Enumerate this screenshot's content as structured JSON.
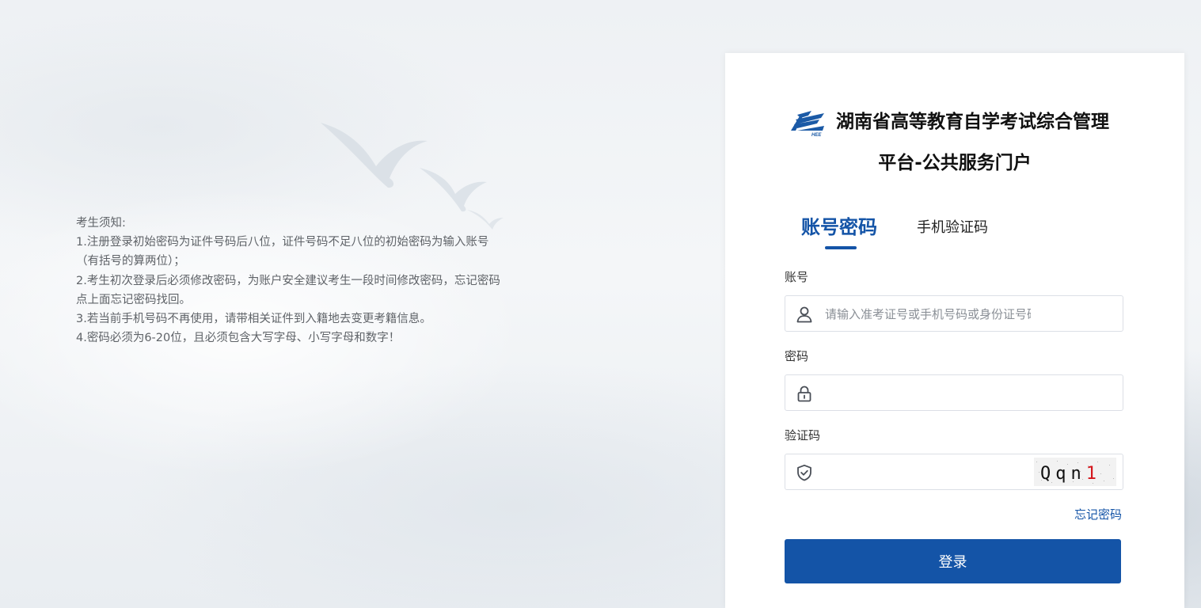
{
  "notice": {
    "heading": "考生须知:",
    "items": [
      "1.注册登录初始密码为证件号码后八位，证件号码不足八位的初始密码为输入账号（有括号的算两位）；",
      "2.考生初次登录后必须修改密码，为账户安全建议考生一段时间修改密码，忘记密码点上面忘记密码找回。",
      "3.若当前手机号码不再使用，请带相关证件到入籍地去变更考籍信息。",
      "4.密码必须为6-20位，且必须包含大写字母、小写字母和数字！"
    ]
  },
  "login": {
    "title_line1": "湖南省高等教育自学考试综合管理",
    "title_line2": "平台-公共服务门户",
    "tabs": [
      {
        "label": "账号密码",
        "active": true
      },
      {
        "label": "手机验证码",
        "active": false
      }
    ],
    "account_label": "账号",
    "account_placeholder": "请输入准考证号或手机号码或身份证号码",
    "account_value": "",
    "password_label": "密码",
    "password_value": "",
    "captcha_label": "验证码",
    "captcha_value": "",
    "captcha_text": "Qqn1",
    "forgot_label": "忘记密码",
    "submit_label": "登录"
  },
  "icons": {
    "account": "user-icon",
    "password": "lock-icon",
    "captcha": "shield-check-icon"
  },
  "colors": {
    "accent": "#1454a7",
    "captcha_last_char": "#d4151b"
  }
}
